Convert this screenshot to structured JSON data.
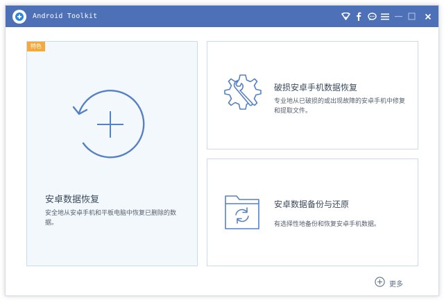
{
  "app": {
    "title": "Android Toolkit",
    "logo_icon": "app-logo-icon",
    "accent_color": "#4d70b6"
  },
  "titlebar_icons": [
    "wifi-icon",
    "facebook-icon",
    "chat-icon",
    "menu-icon",
    "minimize-icon",
    "maximize-icon",
    "close-icon"
  ],
  "features": {
    "main": {
      "badge": "特色",
      "title": "安卓数据恢复",
      "description": "安全地从安卓手机和平板电脑中恢复已删除的数据。",
      "icon": "restore-add-icon"
    },
    "broken": {
      "title": "破损安卓手机数据恢复",
      "description": "专业地从已破损的或出现故障的安卓手机中修复和提取文件。",
      "icon": "gear-wrench-icon"
    },
    "backup": {
      "title": "安卓数据备份与还原",
      "description": "有选择性地备份和恢复安卓手机数据。",
      "icon": "folder-sync-icon"
    }
  },
  "footer": {
    "more_label": "更多",
    "more_icon": "plus-circle-icon"
  }
}
